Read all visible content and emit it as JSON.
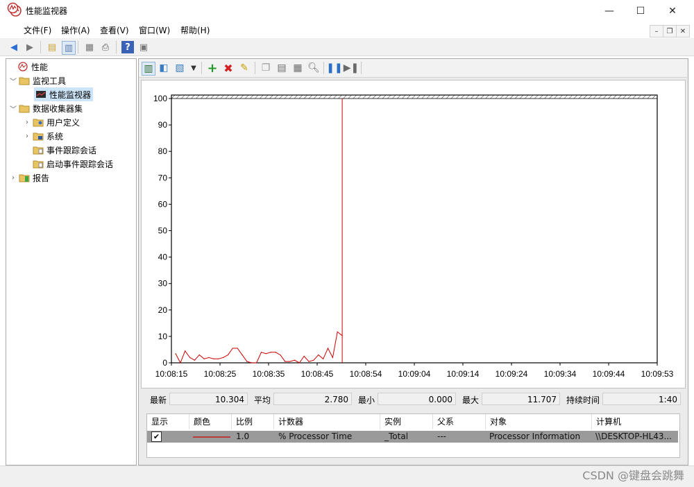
{
  "window": {
    "title": "性能监视器",
    "minimize": "—",
    "maximize": "☐",
    "close": "✕"
  },
  "menu": {
    "items": [
      "文件(F)",
      "操作(A)",
      "查看(V)",
      "窗口(W)",
      "帮助(H)"
    ]
  },
  "mdi": {
    "minimize": "–",
    "restore": "❐",
    "close": "✕"
  },
  "tree": {
    "items": [
      {
        "label": "性能",
        "twist": "",
        "icon": "perf-icon"
      },
      {
        "label": "监视工具",
        "twist": "v",
        "icon": "folder-icon"
      },
      {
        "label": "性能监视器",
        "twist": "",
        "icon": "monitor-chart-icon"
      },
      {
        "label": "数据收集器集",
        "twist": "v",
        "icon": "folder-icon"
      },
      {
        "label": "用户定义",
        "twist": ">",
        "icon": "folder-user-icon"
      },
      {
        "label": "系统",
        "twist": ">",
        "icon": "folder-system-icon"
      },
      {
        "label": "事件跟踪会话",
        "twist": "",
        "icon": "folder-trace-icon"
      },
      {
        "label": "启动事件跟踪会话",
        "twist": "",
        "icon": "folder-trace-icon"
      },
      {
        "label": "报告",
        "twist": ">",
        "icon": "folder-report-icon"
      }
    ]
  },
  "chart_data": {
    "type": "line",
    "ylim": [
      0,
      100
    ],
    "yticks": [
      "100",
      "90",
      "80",
      "70",
      "60",
      "50",
      "40",
      "30",
      "20",
      "10",
      "0"
    ],
    "xticks": [
      "10:08:15",
      "10:08:25",
      "10:08:35",
      "10:08:45",
      "10:08:54",
      "10:09:04",
      "10:09:14",
      "10:09:24",
      "10:09:34",
      "10:09:44",
      "10:09:53"
    ],
    "series": [
      {
        "name": "% Processor Time",
        "color": "#cc0000",
        "values": [
          3.5,
          0,
          4.5,
          2,
          1,
          3,
          1.5,
          2,
          1.5,
          1.5,
          2,
          3,
          5.5,
          5.5,
          3,
          0.5,
          0,
          0,
          4,
          3.5,
          4,
          4,
          3,
          0.5,
          0.5,
          1,
          0,
          2.5,
          0.5,
          1,
          3,
          1.5,
          5.5,
          2,
          11.7,
          10.3
        ]
      }
    ],
    "current_marker": 100
  },
  "stats": {
    "last_label": "最新",
    "last_value": "10.304",
    "avg_label": "平均",
    "avg_value": "2.780",
    "min_label": "最小",
    "min_value": "0.000",
    "max_label": "最大",
    "max_value": "11.707",
    "duration_label": "持续时间",
    "duration_value": "1:40"
  },
  "table": {
    "headers": [
      "显示",
      "颜色",
      "比例",
      "计数器",
      "实例",
      "父系",
      "对象",
      "计算机"
    ],
    "rows": [
      {
        "show": "✔",
        "color": "#cc0000",
        "scale": "1.0",
        "counter": "% Processor Time",
        "instance": "_Total",
        "parent": "---",
        "object": "Processor Information",
        "computer": "\\\\DESKTOP-HL43..."
      }
    ]
  },
  "watermark": "CSDN @键盘会跳舞"
}
